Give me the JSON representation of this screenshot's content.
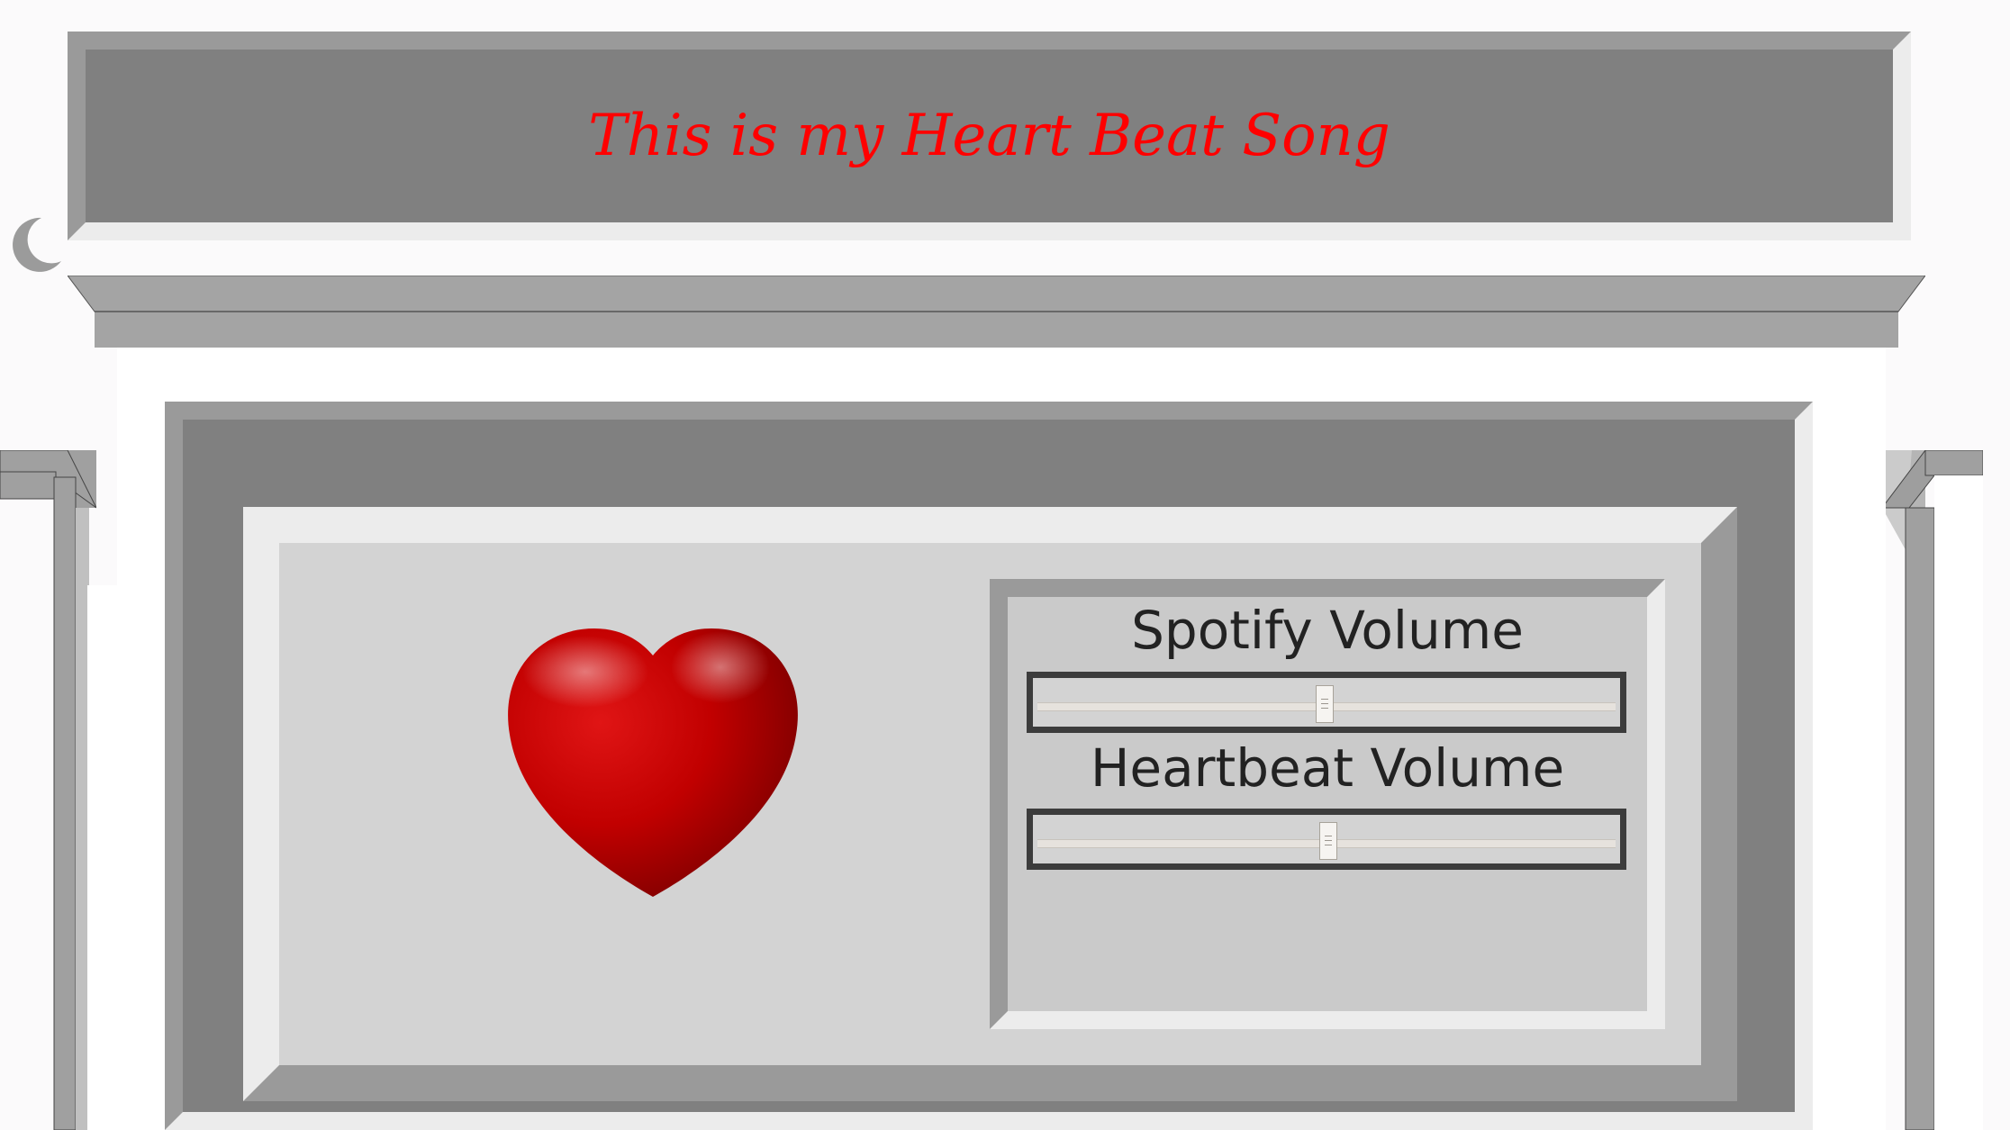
{
  "header": {
    "title": "This is my Heart Beat Song"
  },
  "theme": {
    "title_color": "#ff0000",
    "panel_gray": "#808080",
    "bevel_light": "#ececec",
    "bevel_dark": "#9a9a9a",
    "heart_red": "#d40000"
  },
  "icons": {
    "theme_toggle": "crescent-moon-icon",
    "heart": "heart-icon"
  },
  "controls": {
    "spotify": {
      "label": "Spotify Volume",
      "value": 50
    },
    "heartbeat": {
      "label": "Heartbeat Volume",
      "value": 50
    }
  }
}
